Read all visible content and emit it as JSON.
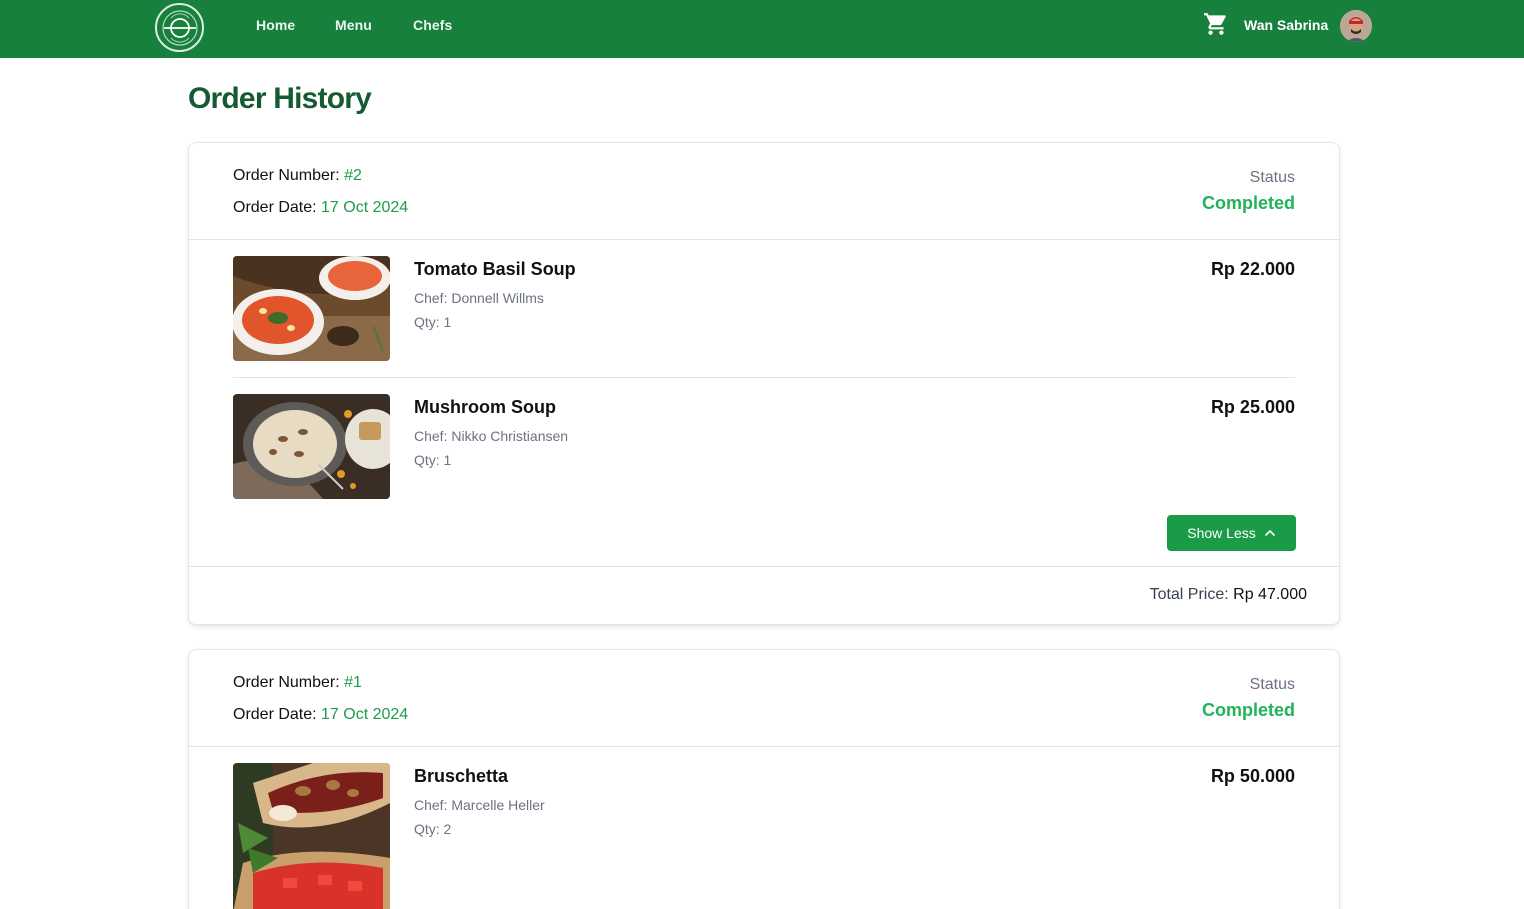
{
  "nav": {
    "links": [
      "Home",
      "Menu",
      "Chefs"
    ],
    "user_name": "Wan Sabrina",
    "brand_color": "#17803d"
  },
  "page": {
    "title": "Order History"
  },
  "orders": [
    {
      "number_label": "Order Number: ",
      "number": "#2",
      "date_label": "Order Date: ",
      "date": "17 Oct 2024",
      "status_label": "Status",
      "status": "Completed",
      "items": [
        {
          "name": "Tomato Basil Soup",
          "chef": "Chef: Donnell Willms",
          "qty": "Qty: 1",
          "price": "Rp 22.000",
          "image": "tomato-soup"
        },
        {
          "name": "Mushroom Soup",
          "chef": "Chef: Nikko Christiansen",
          "qty": "Qty: 1",
          "price": "Rp 25.000",
          "image": "mushroom-soup"
        }
      ],
      "toggle_label": "Show Less",
      "total_label": "Total Price: ",
      "total": "Rp 47.000"
    },
    {
      "number_label": "Order Number: ",
      "number": "#1",
      "date_label": "Order Date: ",
      "date": "17 Oct 2024",
      "status_label": "Status",
      "status": "Completed",
      "items": [
        {
          "name": "Bruschetta",
          "chef": "Chef: Marcelle Heller",
          "qty": "Qty: 2",
          "price": "Rp 50.000",
          "image": "bruschetta"
        }
      ]
    }
  ],
  "colors": {
    "accent_green": "#1e9b4c",
    "status_green": "#22b25a",
    "title_green": "#145a32",
    "button_green": "#1a9b48"
  }
}
